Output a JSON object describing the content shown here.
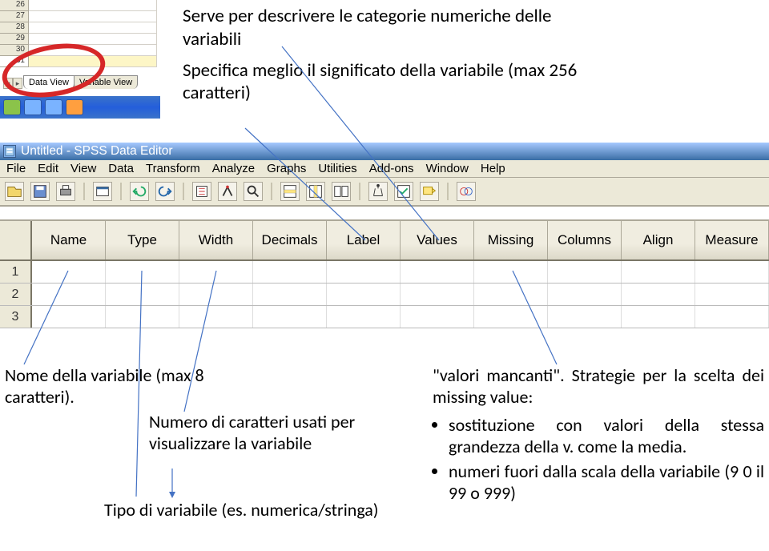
{
  "fragment1": {
    "row_numbers": [
      "26",
      "27",
      "28",
      "29",
      "30",
      "31"
    ],
    "tab_arrows": [
      "◂",
      "▸"
    ],
    "tab_data": "Data View",
    "tab_var": "Variable View"
  },
  "upper_text": {
    "line1": "Serve per descrivere le categorie numeriche delle variabili",
    "line2": "Specifica meglio il significato della variabile (max 256 caratteri)"
  },
  "spss": {
    "window_title": "Untitled - SPSS Data Editor",
    "menus": [
      "File",
      "Edit",
      "View",
      "Data",
      "Transform",
      "Analyze",
      "Graphs",
      "Utilities",
      "Add-ons",
      "Window",
      "Help"
    ],
    "columns": [
      "Name",
      "Type",
      "Width",
      "Decimals",
      "Label",
      "Values",
      "Missing",
      "Columns",
      "Align",
      "Measure"
    ],
    "row_labels": [
      "1",
      "2",
      "3"
    ]
  },
  "bottom_left": {
    "p1": "Nome della variabile (max 8 caratteri).",
    "p2": "Numero di caratteri usati per visualizzare la variabile",
    "p3": "Tipo di variabile (es. numerica/stringa)"
  },
  "bottom_right": {
    "intro": "\"valori mancanti\". Strategie per la scelta dei missing value:",
    "b1": "sostituzione con valori della stessa grandezza della v. come la media.",
    "b2": "numeri fuori dalla scala della variabile (9 0 il 99 o 999)"
  }
}
